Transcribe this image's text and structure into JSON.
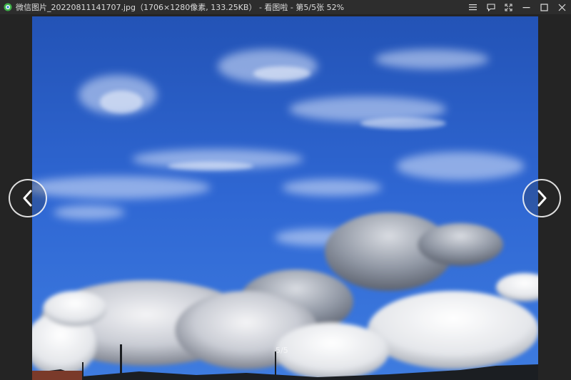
{
  "window": {
    "filename": "微信图片_20220811141707.jpg",
    "file_info": "（1706×1280像素, 133.25KB）",
    "separator": " - ",
    "app_name": "看图啦",
    "page_info": " - 第5/5张 52%"
  },
  "image": {
    "counter": "5/5"
  },
  "colors": {
    "titlebar": "#2d2d2d",
    "background": "#242424",
    "sky": "#2f67d3"
  },
  "icons": {
    "app": "app-logo-icon",
    "menu": "menu-icon",
    "comment": "comment-icon",
    "fullscreen": "fullscreen-icon",
    "minimize": "minimize-icon",
    "maximize": "maximize-icon",
    "close": "close-icon",
    "prev": "chevron-left-icon",
    "next": "chevron-right-icon"
  }
}
